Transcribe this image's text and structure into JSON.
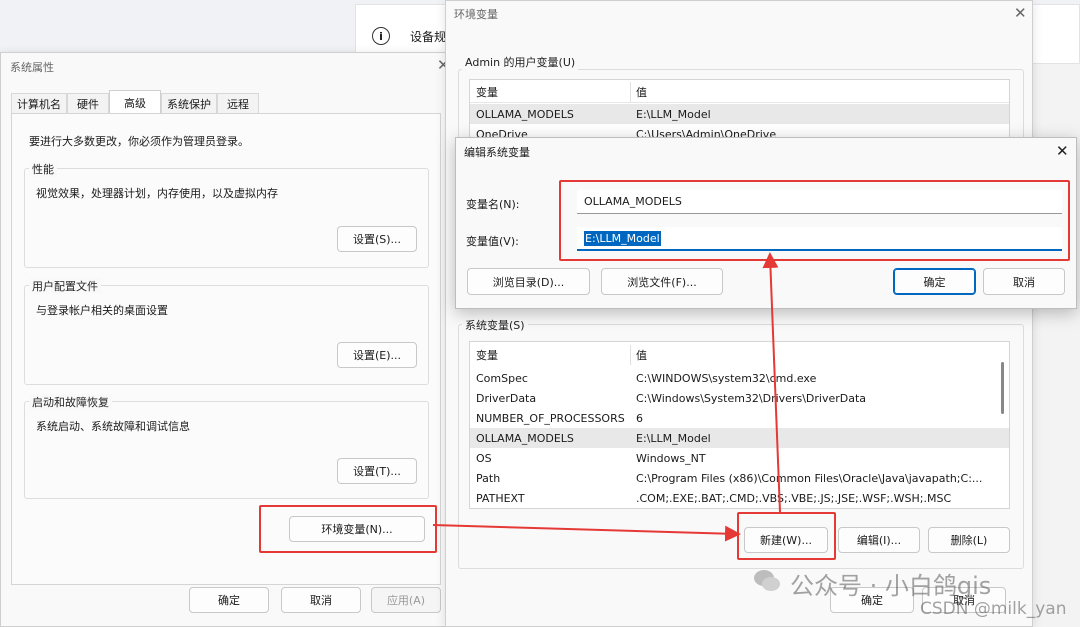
{
  "settings_bg": {
    "label": "设备规"
  },
  "sysprops": {
    "title": "系统属性",
    "tabs": [
      "计算机名",
      "硬件",
      "高级",
      "系统保护",
      "远程"
    ],
    "admin_note": "要进行大多数更改，你必须作为管理员登录。",
    "perf": {
      "title": "性能",
      "desc": "视觉效果，处理器计划，内存使用，以及虚拟内存",
      "btn": "设置(S)..."
    },
    "profile": {
      "title": "用户配置文件",
      "desc": "与登录帐户相关的桌面设置",
      "btn": "设置(E)..."
    },
    "startup": {
      "title": "启动和故障恢复",
      "desc": "系统启动、系统故障和调试信息",
      "btn": "设置(T)..."
    },
    "env_btn": "环境变量(N)...",
    "ok": "确定",
    "cancel": "取消",
    "apply": "应用(A)"
  },
  "envvars": {
    "title": "环境变量",
    "user_title": "Admin 的用户变量(U)",
    "col_var": "变量",
    "col_val": "值",
    "user_rows": [
      {
        "name": "OLLAMA_MODELS",
        "value": "E:\\LLM_Model"
      },
      {
        "name": "OneDrive",
        "value": "C:\\Users\\Admin\\OneDrive"
      }
    ],
    "sys_title": "系统变量(S)",
    "sys_rows": [
      {
        "name": "ComSpec",
        "value": "C:\\WINDOWS\\system32\\cmd.exe"
      },
      {
        "name": "DriverData",
        "value": "C:\\Windows\\System32\\Drivers\\DriverData"
      },
      {
        "name": "NUMBER_OF_PROCESSORS",
        "value": "6"
      },
      {
        "name": "OLLAMA_MODELS",
        "value": "E:\\LLM_Model"
      },
      {
        "name": "OS",
        "value": "Windows_NT"
      },
      {
        "name": "Path",
        "value": "C:\\Program Files (x86)\\Common Files\\Oracle\\Java\\javapath;C:..."
      },
      {
        "name": "PATHEXT",
        "value": ".COM;.EXE;.BAT;.CMD;.VBS;.VBE;.JS;.JSE;.WSF;.WSH;.MSC"
      }
    ],
    "new_btn": "新建(W)...",
    "edit_btn": "编辑(I)...",
    "delete_btn": "删除(L)",
    "ok": "确定",
    "cancel": "取消"
  },
  "editdlg": {
    "title": "编辑系统变量",
    "name_label": "变量名(N):",
    "name_value": "OLLAMA_MODELS",
    "value_label": "变量值(V):",
    "value_value": "E:\\LLM_Model",
    "browse_dir": "浏览目录(D)...",
    "browse_file": "浏览文件(F)...",
    "ok": "确定",
    "cancel": "取消"
  },
  "watermark": {
    "wechat": "公众号 · 小白鸽gis",
    "csdn": "CSDN @milk_yan"
  },
  "colors": {
    "highlight": "#e53935",
    "selection": "#0067c0",
    "window_bg": "#f9f9f9"
  }
}
